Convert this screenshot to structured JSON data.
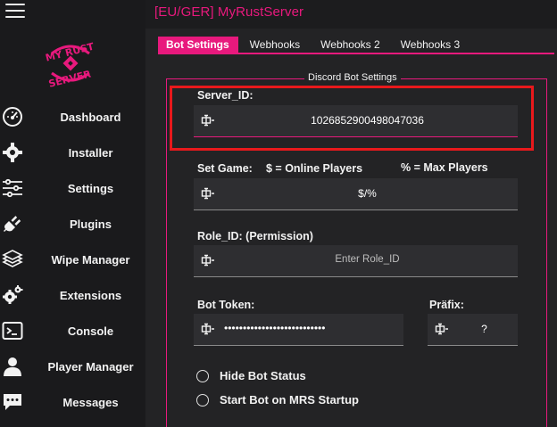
{
  "app": {
    "title": "[EU/GER] MyRustServer",
    "logo_text": "MY RUST SERVER"
  },
  "sidebar": {
    "items": [
      {
        "label": "Dashboard",
        "icon": "gauge-icon"
      },
      {
        "label": "Installer",
        "icon": "gear-icon"
      },
      {
        "label": "Settings",
        "icon": "sliders-icon"
      },
      {
        "label": "Plugins",
        "icon": "plug-icon"
      },
      {
        "label": "Wipe Manager",
        "icon": "layers-icon"
      },
      {
        "label": "Extensions",
        "icon": "gears-icon"
      },
      {
        "label": "Console",
        "icon": "terminal-icon"
      },
      {
        "label": "Player Manager",
        "icon": "user-icon"
      },
      {
        "label": "Messages",
        "icon": "chat-icon"
      }
    ]
  },
  "tabs": [
    {
      "label": "Bot Settings",
      "active": true
    },
    {
      "label": "Webhooks",
      "active": false
    },
    {
      "label": "Webhooks 2",
      "active": false
    },
    {
      "label": "Webhooks 3",
      "active": false
    }
  ],
  "section": {
    "legend": "Discord Bot Settings",
    "server_id": {
      "label": "Server_ID:",
      "value": "1026852900498047036"
    },
    "set_game": {
      "label": "Set Game:",
      "hint_online": "$ = Online Players",
      "hint_max": "% = Max Players",
      "value": "$/%"
    },
    "role_id": {
      "label": "Role_ID: (Permission)",
      "placeholder": "Enter Role_ID"
    },
    "bot_token": {
      "label": "Bot Token:",
      "value": "•••••••••••••••••••••••••••"
    },
    "prefix": {
      "label": "Präfix:",
      "value": "?"
    },
    "options": [
      {
        "label": "Hide Bot Status",
        "checked": false
      },
      {
        "label": "Start Bot on MRS Startup",
        "checked": false
      }
    ]
  },
  "colors": {
    "accent": "#e8197d",
    "highlight": "#e8191c",
    "background": "#1c1c1e",
    "panel": "#232325",
    "input": "#2e2e31"
  }
}
